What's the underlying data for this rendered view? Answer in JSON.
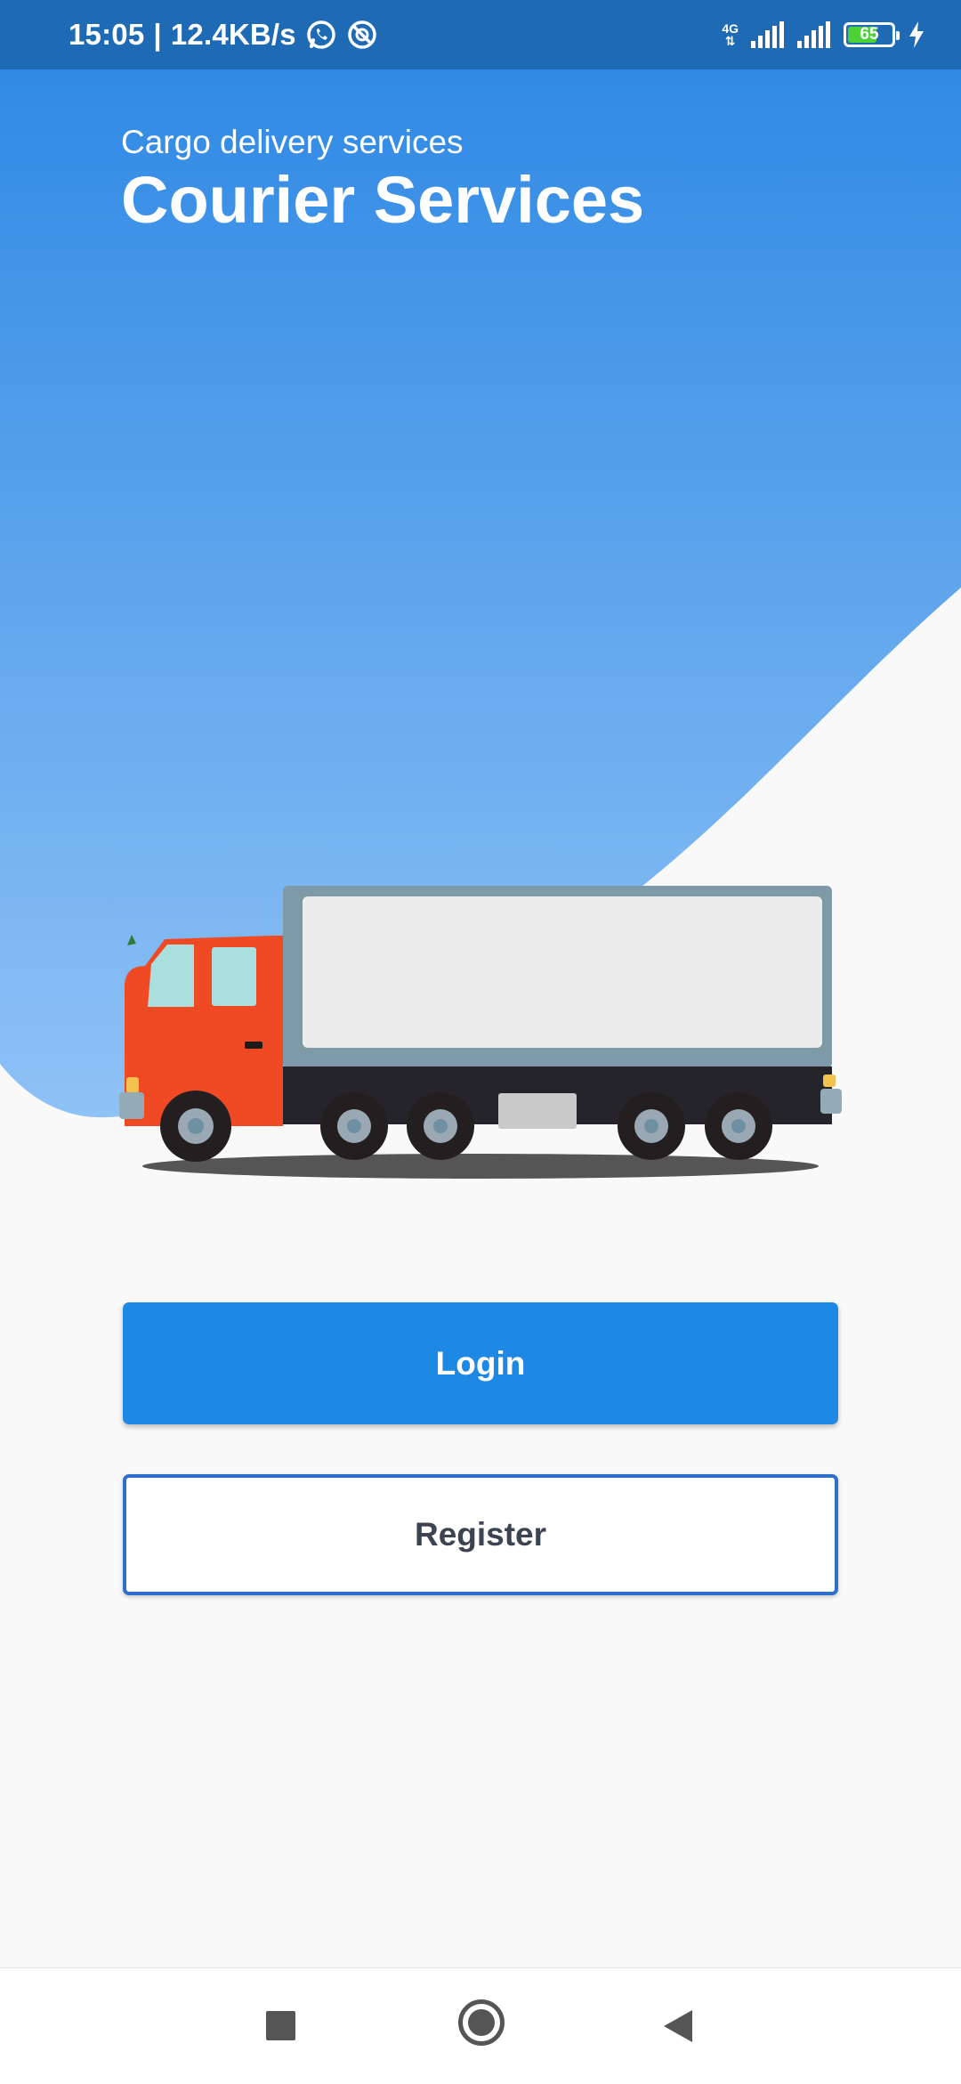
{
  "status_bar": {
    "time": "15:05",
    "separator": "|",
    "speed": "12.4KB/s",
    "network_label": "4G",
    "battery_percent": "65",
    "icons": [
      "whatsapp-icon",
      "sync-blocked-icon",
      "signal-icon",
      "signal-icon",
      "battery-icon",
      "charging-icon"
    ]
  },
  "header": {
    "subtitle": "Cargo delivery services",
    "title": "Courier Services"
  },
  "illustration": {
    "name": "truck-illustration"
  },
  "actions": {
    "login_label": "Login",
    "register_label": "Register"
  },
  "navigation": {
    "buttons": [
      "recents",
      "home",
      "back"
    ]
  },
  "colors": {
    "status_bar": "#1e6ab5",
    "gradient_top": "#2a86e3",
    "gradient_bottom": "#8fc2f6",
    "primary_button": "#1e88e5",
    "register_border": "#2f6fcc",
    "background": "#f9f9f9",
    "truck_cab": "#f04a24",
    "truck_box": "#ececec"
  }
}
